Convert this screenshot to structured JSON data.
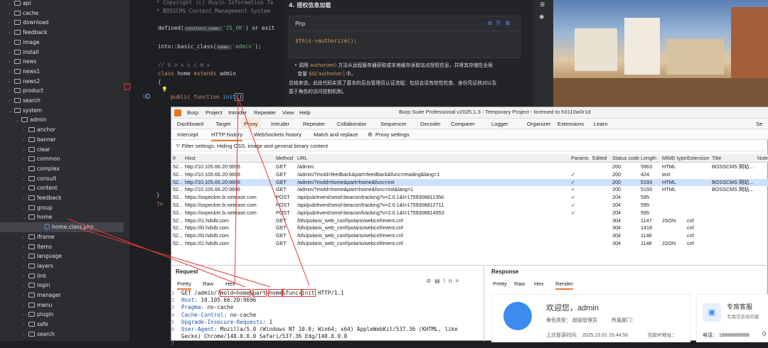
{
  "tree": {
    "items": [
      {
        "label": "api",
        "indent": 0,
        "open": false
      },
      {
        "label": "cache",
        "indent": 0,
        "open": false
      },
      {
        "label": "download",
        "indent": 0,
        "open": false
      },
      {
        "label": "feedback",
        "indent": 0,
        "open": false
      },
      {
        "label": "image",
        "indent": 0,
        "open": false
      },
      {
        "label": "install",
        "indent": 0,
        "open": false
      },
      {
        "label": "news",
        "indent": 0,
        "open": false
      },
      {
        "label": "news1",
        "indent": 0,
        "open": false
      },
      {
        "label": "news2",
        "indent": 0,
        "open": false
      },
      {
        "label": "product",
        "indent": 0,
        "open": false
      },
      {
        "label": "search",
        "indent": 0,
        "open": false
      },
      {
        "label": "system",
        "indent": 0,
        "open": true
      },
      {
        "label": "admin",
        "indent": 1,
        "open": true
      },
      {
        "label": "anchor",
        "indent": 2,
        "open": false
      },
      {
        "label": "banner",
        "indent": 2,
        "open": false
      },
      {
        "label": "clear",
        "indent": 2,
        "open": false
      },
      {
        "label": "common",
        "indent": 2,
        "open": false
      },
      {
        "label": "complex",
        "indent": 2,
        "open": false
      },
      {
        "label": "consult",
        "indent": 2,
        "open": false
      },
      {
        "label": "content",
        "indent": 2,
        "open": false
      },
      {
        "label": "feedback",
        "indent": 2,
        "open": false
      },
      {
        "label": "group",
        "indent": 2,
        "open": false
      },
      {
        "label": "home",
        "indent": 2,
        "open": true
      },
      {
        "label": "home.class.php",
        "indent": 3,
        "file": true
      },
      {
        "label": "iframe",
        "indent": 2,
        "open": false
      },
      {
        "label": "items",
        "indent": 2,
        "open": false
      },
      {
        "label": "language",
        "indent": 2,
        "open": false
      },
      {
        "label": "layers",
        "indent": 2,
        "open": false
      },
      {
        "label": "link",
        "indent": 2,
        "open": false
      },
      {
        "label": "login",
        "indent": 2,
        "open": false
      },
      {
        "label": "manager",
        "indent": 2,
        "open": false
      },
      {
        "label": "menu",
        "indent": 2,
        "open": false
      },
      {
        "label": "plugin",
        "indent": 2,
        "open": false
      },
      {
        "label": "safe",
        "indent": 2,
        "open": false
      },
      {
        "label": "search",
        "indent": 2,
        "open": false
      }
    ]
  },
  "editor": {
    "l1a": " * Copyright (c) Huyin Information Te",
    "l2a": " * BOSSCMS Content Management System",
    "l3a": "defined(",
    "l3hint": "constant_name:",
    "l3b": "'IS_OK'",
    "l3c": ") or exit",
    "l5a": "into::basic_class(",
    "l5hint": "name:",
    "l5b": "'admin'",
    "l5c": ");",
    "l7": "// b o s s c m s",
    "l8a": "class",
    "l8b": "home",
    "l8c": "extends",
    "l8d": "admin",
    "l9": "{",
    "l11a": "public",
    "l11b": "function",
    "l11c": "init",
    "l11d": "()",
    "l11num": "13",
    "close1": "}",
    "close2": "?>"
  },
  "doc": {
    "heading": "4. 授权信息加载",
    "lang": "Php",
    "code": "$this->authorize();",
    "bullet_pre": "调用 ",
    "bullet_code": "authorize()",
    "bullet_post": " 方法从远程服务器获取或本地缓存读取站点授权信息，并将其存储在全局",
    "bullet_line2_pre": "变量 ",
    "bullet_line2_code": "$G['authorize']",
    "bullet_line2_post": " 中。",
    "summary1": "总结来说，此段代码实现了基本的后台管理员认证流程：包括会话有效性检查、身份凭证核对以及",
    "summary2": "基于角色的访问控制机制。"
  },
  "burp": {
    "title": "Burp Suite Professional v2025.1.3 - Temporary Project - licensed to h3110w0r1d",
    "menu": [
      "Burp",
      "Project",
      "Intruder",
      "Repeater",
      "View",
      "Help"
    ],
    "tabs": [
      "Dashboard",
      "Target",
      "Proxy",
      "Intruder",
      "Repeater",
      "Collaborator",
      "Sequencer",
      "Decoder",
      "Comparer",
      "Logger",
      "Organizer",
      "Extensions",
      "Learn"
    ],
    "search_label": "Se",
    "subtabs": [
      "Intercept",
      "HTTP history",
      "WebSockets history",
      "Match and replace",
      "Proxy settings"
    ],
    "filter": "Filter settings: Hiding CSS, image and general binary content",
    "columns": [
      "#",
      "Host",
      "Method",
      "URL",
      "Params",
      "Edited",
      "Status code",
      "Length",
      "MIME type",
      "Extension",
      "Title",
      "Notes"
    ],
    "rows": [
      {
        "n": "52...",
        "host": "http://10.105.66.20:9696",
        "m": "GET",
        "url": "/admin/",
        "p": "",
        "s": "200",
        "len": "5963",
        "mime": "HTML",
        "ext": "",
        "title": "BOSSCMS 网站..."
      },
      {
        "n": "52...",
        "host": "http://10.105.66.20:9696",
        "m": "GET",
        "url": "/admin/?mold=feedback&part=feedback&func=reading&lang=1",
        "p": "✓",
        "s": "200",
        "len": "424",
        "mime": "text",
        "ext": "",
        "title": ""
      },
      {
        "n": "52...",
        "host": "http://10.105.66.20:9696",
        "m": "GET",
        "url": "/admin/?mold=home&part=home&func=init",
        "p": "✓",
        "s": "200",
        "len": "5193",
        "mime": "HTML",
        "ext": "",
        "title": "BOSSCMS 网站..."
      },
      {
        "n": "52...",
        "host": "http://10.105.66.20:9696",
        "m": "GET",
        "url": "/admin/?mold=home&part=home&func=init&lang=1",
        "p": "✓",
        "s": "200",
        "len": "5193",
        "mime": "HTML",
        "ext": "",
        "title": "BOSSCMS 网站..."
      },
      {
        "n": "53...",
        "host": "https://oxpecker.lx.netease.com",
        "m": "POST",
        "url": "/api/pub/event/send-beacon/tracking?v=2.0.1&t=1759308811356",
        "p": "✓",
        "s": "204",
        "len": "595",
        "mime": "",
        "ext": "",
        "title": ""
      },
      {
        "n": "53...",
        "host": "https://oxpecker.lx.netease.com",
        "m": "POST",
        "url": "/api/pub/event/send-beacon/tracking?v=2.0.1&t=1759308812711",
        "p": "✓",
        "s": "204",
        "len": "595",
        "mime": "",
        "ext": "",
        "title": ""
      },
      {
        "n": "53...",
        "host": "https://oxpecker.lx.netease.com",
        "m": "POST",
        "url": "/api/pub/event/send-beacon/tracking?v=2.0.1&t=1759308814553",
        "p": "✓",
        "s": "204",
        "len": "595",
        "mime": "",
        "ext": "",
        "title": ""
      },
      {
        "n": "52...",
        "host": "https://i1.hdslb.com",
        "m": "GET",
        "url": "/bfs/polaris_web_conf/polaris/webcnf/event.cnf",
        "p": "",
        "s": "304",
        "len": "1147",
        "mime": "JSON",
        "ext": "cnf",
        "title": ""
      },
      {
        "n": "52...",
        "host": "https://i0.hdslb.com",
        "m": "GET",
        "url": "/bfs/polaris_web_conf/polaris/webcnf/event.cnf",
        "p": "",
        "s": "304",
        "len": "1418",
        "mime": "",
        "ext": "cnf",
        "title": ""
      },
      {
        "n": "52...",
        "host": "https://i0.hdslb.com",
        "m": "GET",
        "url": "/bfs/polaris_web_conf/polaris/webcnf/event.cnf",
        "p": "",
        "s": "304",
        "len": "1146",
        "mime": "",
        "ext": "cnf",
        "title": ""
      },
      {
        "n": "52...",
        "host": "https://i1.hdslb.com",
        "m": "GET",
        "url": "/bfs/polaris_web_conf/polaris/webcnf/event.cnf",
        "p": "",
        "s": "304",
        "len": "1148",
        "mime": "JSON",
        "ext": "cnf",
        "title": ""
      }
    ],
    "request": {
      "title": "Request",
      "tabs": [
        "Pretty",
        "Raw",
        "Hex"
      ],
      "l1a": "GET /admin/?",
      "l1b": "mold=home",
      "l1c": "&",
      "l1d": "part",
      "l1e": "=",
      "l1f": "home",
      "l1g": "&func=",
      "l1h": "init",
      "l1i": " HTTP/1.1",
      "headers": [
        {
          "k": "Host:",
          "v": " 10.105.66.20:9696"
        },
        {
          "k": "Pragma:",
          "v": " no-cache"
        },
        {
          "k": "Cache-Control:",
          "v": " no-cache"
        },
        {
          "k": "Upgrade-Insecure-Requests:",
          "v": " 1"
        },
        {
          "k": "User-Agent:",
          "v": " Mozilla/5.0 (Windows NT 10.0; Win64; x64) AppleWebKit/537.36 (KHTML, like"
        },
        {
          "k": "",
          "v": "Gecko) Chrome/140.0.0.0 Safari/537.36 Edg/140.0.0.0"
        }
      ],
      "line_nums": [
        "1",
        "2",
        "3",
        "4",
        "5",
        "6",
        "",
        "7"
      ]
    },
    "response": {
      "title": "Response",
      "tabs": [
        "Pretty",
        "Raw",
        "Hex",
        "Render"
      ],
      "welcome": "欢迎您，admin",
      "role": "角色类型：  超级管理员",
      "dept": "所属部门：",
      "last_login": "上次登录时间： 2025.10.01 16:44:56",
      "ip": "当前IP地址：",
      "service_title": "专席客服",
      "service_sub": "专属您系统的客",
      "phone": "电话：  18888888888",
      "q": "Q"
    }
  },
  "colors": {
    "accent": "#e57c33",
    "annotation": "#e23a3a",
    "selected_row": "#cfe0fb"
  }
}
